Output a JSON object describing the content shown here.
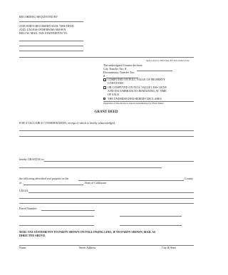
{
  "header": {
    "recording_requested_by": "RECORDING REQUESTED BY",
    "mail_instructions": [
      "AND WHEN RECORDED MAIL THIS DEED",
      "AND, UNLESS OTHERWISE SHOWN",
      "BELOW, MAIL TAX STATEMENTS TO:"
    ]
  },
  "recorder": {
    "space_note": "Space Above This Line For Recorder's Use",
    "grantor_declares": "The undersigned Grantor declares:",
    "city_transfer_tax": "City Transfer Tax: $",
    "documentary_transfer_tax": "Documentary Transfer Tax:",
    "dollar": "$",
    "option1": [
      "COMPUTED ON FULL VALUE OF PROPERTY",
      "CONVEYED"
    ],
    "option2": [
      "OR COMPUTED ON FULL VALUE LESS LIENS",
      "AND ENCUMBRANCES REMAINING AT TIME",
      "OF SALE."
    ],
    "declares": "THE UNDERSIGNED HEREBY DECLARES",
    "signature_caption": "Signature of Declarant or Agent determining tax  Firm Name"
  },
  "body": {
    "title": "GRANT DEED",
    "consideration": "FOR A VALUABLE CONSIDERATION, receipt of which is hereby acknowledged,",
    "grants_to": "hereby GRANT(S) to",
    "property_in": "the following described real property in the",
    "county": ", County",
    "of": "of",
    "state": ", State of California:",
    "legal": "LEGAL",
    "parcel_number": "Parcel Number:"
  },
  "footer": {
    "mail_statements": [
      "MAIL TAX STATEMENTS TO PARTY SHOWN ON FOLLOWING LINE; IF NO PARTY SHOWN, MAIL AS",
      "DIRECTED ABOVE."
    ],
    "name": "Name",
    "street_address": "Street Address",
    "city_state": "City & State"
  }
}
